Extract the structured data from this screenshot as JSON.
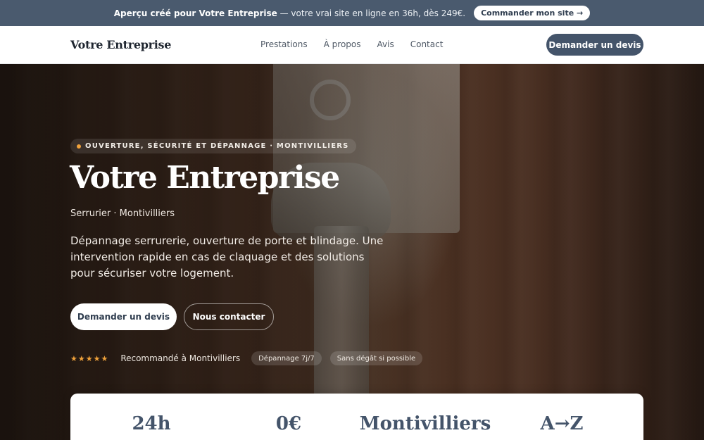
{
  "promo": {
    "brand": "Aperçu créé pour Votre Entreprise",
    "text": " — votre vrai site en ligne en 36h, dès 249€.",
    "button": "Commander mon site →"
  },
  "header": {
    "brand": "Votre Entreprise",
    "nav": [
      "Prestations",
      "À propos",
      "Avis",
      "Contact"
    ],
    "cta": "Demander un devis"
  },
  "hero": {
    "eyebrow": "OUVERTURE, SÉCURITÉ ET DÉPANNAGE · MONTIVILLIERS",
    "title": "Votre Entreprise",
    "subtitle": "Serrurier · Montivilliers",
    "description": "Dépannage serrurerie, ouverture de porte et blindage. Une intervention rapide en cas de claquage et des solutions pour sécuriser votre logement.",
    "primary_button": "Demander un devis",
    "secondary_button": "Nous contacter",
    "stars": "★★★★★",
    "rating_text": "Recommandé à Montivilliers",
    "badges": [
      "Dépannage 7j/7",
      "Sans dégât si possible"
    ]
  },
  "stats": [
    "24h",
    "0€",
    "Montivilliers",
    "A→Z"
  ],
  "colors": {
    "promo_bg": "#4a5a6e",
    "accent": "#44546a",
    "star": "#f0a23b"
  }
}
